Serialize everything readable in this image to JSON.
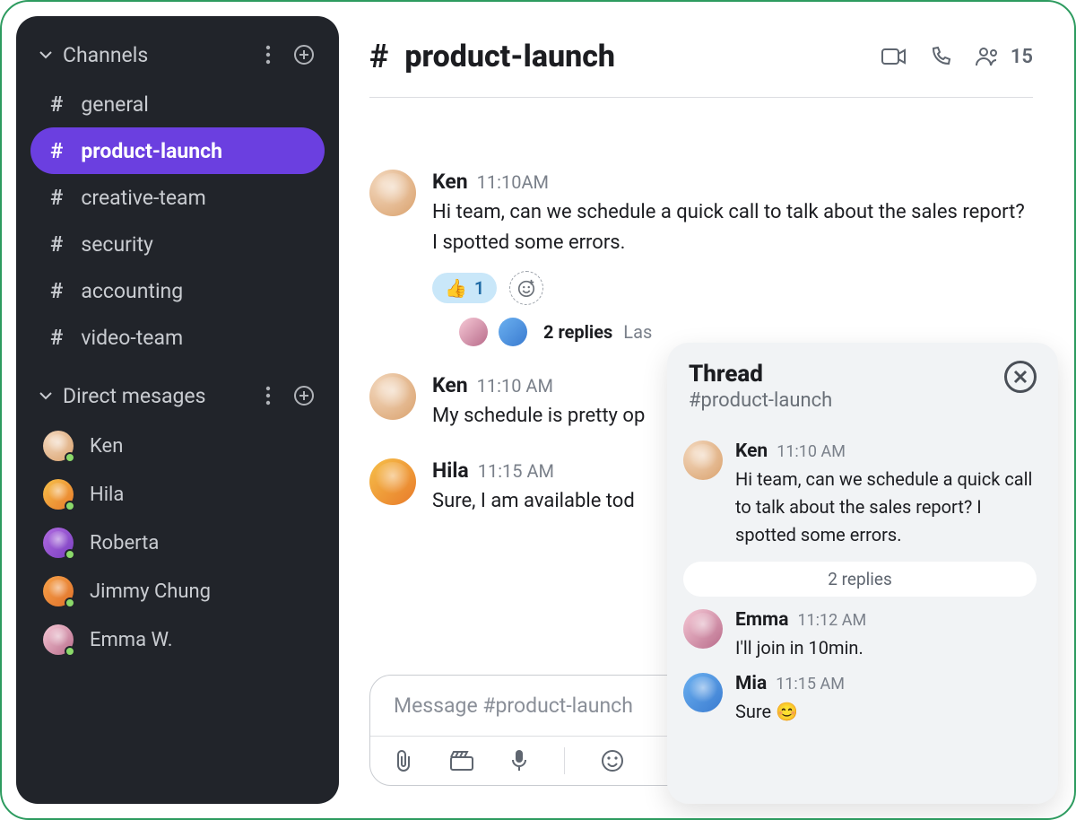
{
  "sidebar": {
    "channels_label": "Channels",
    "dm_label": "Direct mesages",
    "channels": [
      {
        "name": "general",
        "active": false
      },
      {
        "name": "product-launch",
        "active": true
      },
      {
        "name": "creative-team",
        "active": false
      },
      {
        "name": "security",
        "active": false
      },
      {
        "name": "accounting",
        "active": false
      },
      {
        "name": "video-team",
        "active": false
      }
    ],
    "dms": [
      {
        "name": "Ken"
      },
      {
        "name": "Hila"
      },
      {
        "name": "Roberta"
      },
      {
        "name": "Jimmy Chung"
      },
      {
        "name": "Emma W."
      }
    ]
  },
  "header": {
    "channel_name": "product-launch",
    "member_count": "15"
  },
  "messages": [
    {
      "author": "Ken",
      "time": "11:10AM",
      "text": "Hi team, can we schedule a quick call to talk about the sales report? I spotted some errors.",
      "reaction_emoji": "👍",
      "reaction_count": "1",
      "replies_label": "2 replies",
      "last_label": "Las"
    },
    {
      "author": "Ken",
      "time": "11:10 AM",
      "text": "My schedule is pretty op"
    },
    {
      "author": "Hila",
      "time": "11:15 AM",
      "text": "Sure, I am available tod"
    }
  ],
  "composer": {
    "placeholder": "Message #product-launch"
  },
  "thread": {
    "title": "Thread",
    "subtitle": "#product-launch",
    "root": {
      "author": "Ken",
      "time": "11:10 AM",
      "text": "Hi team, can we schedule a quick call to talk about the sales report? I spotted some errors."
    },
    "replies_label": "2 replies",
    "replies": [
      {
        "author": "Emma",
        "time": "11:12 AM",
        "text": "I'll join in 10min."
      },
      {
        "author": "Mia",
        "time": "11:15 AM",
        "text": "Sure 😊"
      }
    ]
  }
}
